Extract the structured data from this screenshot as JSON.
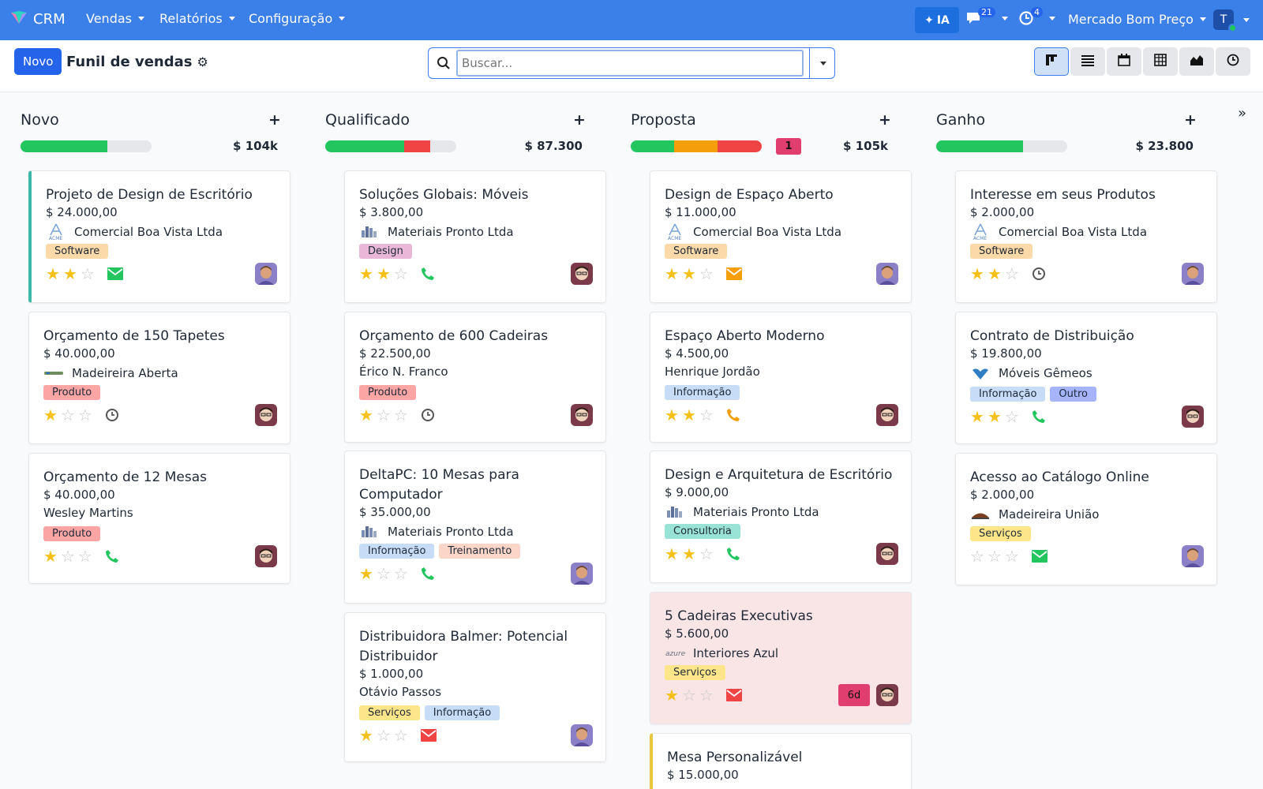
{
  "app": {
    "name": "CRM"
  },
  "nav": {
    "menus": [
      "Vendas",
      "Relatórios",
      "Configuração"
    ],
    "ia_label": "IA",
    "messages_count": "21",
    "activities_count": "4",
    "company": "Mercado Bom Preço",
    "user_initial": "T"
  },
  "control": {
    "new_button": "Novo",
    "title": "Funil de vendas",
    "search_placeholder": "Buscar..."
  },
  "views": [
    "kanban-icon",
    "list-icon",
    "calendar-icon",
    "pivot-icon",
    "graph-icon",
    "activity-icon"
  ],
  "colors": {
    "green": "#22c55e",
    "red": "#ef4444",
    "orange": "#f59e0b",
    "accent": "#3b7fe8"
  },
  "columns": [
    {
      "title": "Novo",
      "total": "$ 104k",
      "progress": {
        "green": 0.66,
        "red": 0,
        "orange": 0
      },
      "cards": [
        {
          "title": "Projeto de Design de Escritório",
          "amount": "$ 24.000,00",
          "company": "Comercial Boa Vista Ltda",
          "logo": "acme",
          "tags": [
            {
              "label": "Software",
              "bg": "#fcd9a8"
            }
          ],
          "stars": 2,
          "activity": "email-green",
          "avatar": "a"
        },
        {
          "title": "Orçamento de 150 Tapetes",
          "amount": "$ 40.000,00",
          "company": "Madeireira Aberta",
          "logo": "wood",
          "tags": [
            {
              "label": "Produto",
              "bg": "#fca5a5"
            }
          ],
          "stars": 1,
          "activity": "clock",
          "avatar": "b"
        },
        {
          "title": "Orçamento de 12 Mesas",
          "amount": "$ 40.000,00",
          "company": "Wesley Martins",
          "logo": "",
          "tags": [
            {
              "label": "Produto",
              "bg": "#fca5a5"
            }
          ],
          "stars": 1,
          "activity": "phone-green",
          "avatar": "b"
        }
      ]
    },
    {
      "title": "Qualificado",
      "total": "$ 87.300",
      "progress": {
        "green": 0.6,
        "red": 0.2,
        "orange": 0
      },
      "cards": [
        {
          "title": "Soluções Globais: Móveis",
          "amount": "$ 3.800,00",
          "company": "Materiais Pronto Ltda",
          "logo": "ready",
          "tags": [
            {
              "label": "Design",
              "bg": "#e9b8d8"
            }
          ],
          "stars": 2,
          "activity": "phone-green",
          "avatar": "b"
        },
        {
          "title": "Orçamento de 600 Cadeiras",
          "amount": "$ 22.500,00",
          "company": "Érico N. Franco",
          "logo": "",
          "tags": [
            {
              "label": "Produto",
              "bg": "#fca5a5"
            }
          ],
          "stars": 1,
          "activity": "clock",
          "avatar": "b"
        },
        {
          "title": "DeltaPC: 10 Mesas para Computador",
          "amount": "$ 35.000,00",
          "company": "Materiais Pronto Ltda",
          "logo": "ready",
          "tags": [
            {
              "label": "Informação",
              "bg": "#c7dcf7"
            },
            {
              "label": "Treinamento",
              "bg": "#fbd5c8"
            }
          ],
          "stars": 1,
          "activity": "phone-green",
          "avatar": "a"
        },
        {
          "title": "Distribuidora Balmer: Potencial Distribuidor",
          "amount": "$ 1.000,00",
          "company": "Otávio Passos",
          "logo": "",
          "tags": [
            {
              "label": "Serviços",
              "bg": "#fde68a"
            },
            {
              "label": "Informação",
              "bg": "#c7dcf7"
            }
          ],
          "stars": 1,
          "activity": "email-red",
          "avatar": "a"
        }
      ]
    },
    {
      "title": "Proposta",
      "total": "$ 105k",
      "badge": "1",
      "progress": {
        "green": 0.33,
        "orange": 0.33,
        "red": 0.34
      },
      "cards": [
        {
          "title": "Design de Espaço Aberto",
          "amount": "$ 11.000,00",
          "company": "Comercial Boa Vista Ltda",
          "logo": "acme",
          "tags": [
            {
              "label": "Software",
              "bg": "#fcd9a8"
            }
          ],
          "stars": 2,
          "activity": "email-orange",
          "avatar": "a"
        },
        {
          "title": "Espaço Aberto Moderno",
          "amount": "$ 4.500,00",
          "company": "Henrique Jordão",
          "logo": "",
          "tags": [
            {
              "label": "Informação",
              "bg": "#c7dcf7"
            }
          ],
          "stars": 2,
          "activity": "phone-orange",
          "avatar": "b"
        },
        {
          "title": "Design e Arquitetura de Escritório",
          "amount": "$ 9.000,00",
          "company": "Materiais Pronto Ltda",
          "logo": "ready",
          "tags": [
            {
              "label": "Consultoria",
              "bg": "#99e3d6"
            }
          ],
          "stars": 2,
          "activity": "phone-green",
          "avatar": "b"
        },
        {
          "title": "5 Cadeiras Executivas",
          "amount": "$ 5.600,00",
          "company": "Interiores Azul",
          "logo": "azure",
          "tags": [
            {
              "label": "Serviços",
              "bg": "#fde68a"
            }
          ],
          "stars": 1,
          "activity": "email-red",
          "avatar": "b",
          "days": "6d"
        },
        {
          "title": "Mesa Personalizável",
          "amount": "$ 15.000,00",
          "company": "",
          "logo": "",
          "tags": [],
          "stars": 0,
          "activity": "",
          "avatar": ""
        }
      ]
    },
    {
      "title": "Ganho",
      "total": "$ 23.800",
      "progress": {
        "green": 0.66,
        "red": 0,
        "orange": 0
      },
      "cards": [
        {
          "title": "Interesse em seus Produtos",
          "amount": "$ 2.000,00",
          "company": "Comercial Boa Vista Ltda",
          "logo": "acme",
          "tags": [
            {
              "label": "Software",
              "bg": "#fcd9a8"
            }
          ],
          "stars": 2,
          "activity": "clock",
          "avatar": "a"
        },
        {
          "title": "Contrato de Distribuição",
          "amount": "$ 19.800,00",
          "company": "Móveis Gêmeos",
          "logo": "gemini",
          "tags": [
            {
              "label": "Informação",
              "bg": "#c7dcf7"
            },
            {
              "label": "Outro",
              "bg": "#a5b4fc"
            }
          ],
          "stars": 2,
          "activity": "phone-green",
          "avatar": "b"
        },
        {
          "title": "Acesso ao Catálogo Online",
          "amount": "$ 2.000,00",
          "company": "Madeireira União",
          "logo": "union",
          "tags": [
            {
              "label": "Serviços",
              "bg": "#fde68a"
            }
          ],
          "stars": 0,
          "activity": "email-green",
          "avatar": "a"
        }
      ]
    }
  ]
}
